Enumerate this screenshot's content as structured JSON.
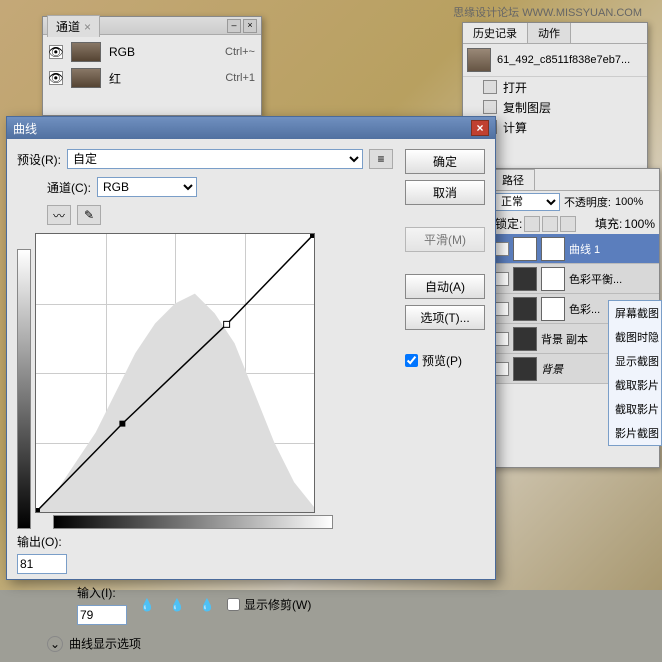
{
  "watermark": "思缘设计论坛  WWW.MISSYUAN.COM",
  "channels": {
    "tab": "通道",
    "items": [
      {
        "name": "RGB",
        "shortcut": "Ctrl+~"
      },
      {
        "name": "红",
        "shortcut": "Ctrl+1"
      }
    ]
  },
  "history": {
    "tabs": [
      "历史记录",
      "动作"
    ],
    "filename": "61_492_c8511f838e7eb7...",
    "items": [
      "打开",
      "复制图层",
      "计算"
    ]
  },
  "layers": {
    "tab_paths": "路径",
    "blend_mode": "正常",
    "opacity_label": "不透明度:",
    "opacity_value": "100%",
    "lock_label": "锁定:",
    "fill_label": "填充:",
    "fill_value": "100%",
    "items": [
      {
        "name": "曲线 1",
        "selected": true
      },
      {
        "name": "色彩平衡..."
      },
      {
        "name": "色彩..."
      },
      {
        "name": "背景 副本"
      },
      {
        "name": "背景",
        "italic": true
      }
    ]
  },
  "context_menu": [
    "屏幕截图",
    "截图时隐",
    "显示截图",
    "截取影片",
    "截取影片",
    "影片截图"
  ],
  "curves": {
    "title": "曲线",
    "preset_label": "预设(R):",
    "preset_value": "自定",
    "channel_label": "通道(C):",
    "channel_value": "RGB",
    "output_label": "输出(O):",
    "output_value": "81",
    "input_label": "输入(I):",
    "input_value": "79",
    "show_clip": "显示修剪(W)",
    "expand_label": "曲线显示选项",
    "buttons": {
      "ok": "确定",
      "cancel": "取消",
      "smooth": "平滑(M)",
      "auto": "自动(A)",
      "options": "选项(T)...",
      "preview": "预览(P)"
    }
  },
  "chart_data": {
    "type": "line",
    "title": "曲线",
    "xlabel": "输入",
    "ylabel": "输出",
    "xlim": [
      0,
      255
    ],
    "ylim": [
      0,
      255
    ],
    "points": [
      {
        "x": 0,
        "y": 0
      },
      {
        "x": 79,
        "y": 81
      },
      {
        "x": 175,
        "y": 172
      },
      {
        "x": 255,
        "y": 255
      }
    ]
  }
}
